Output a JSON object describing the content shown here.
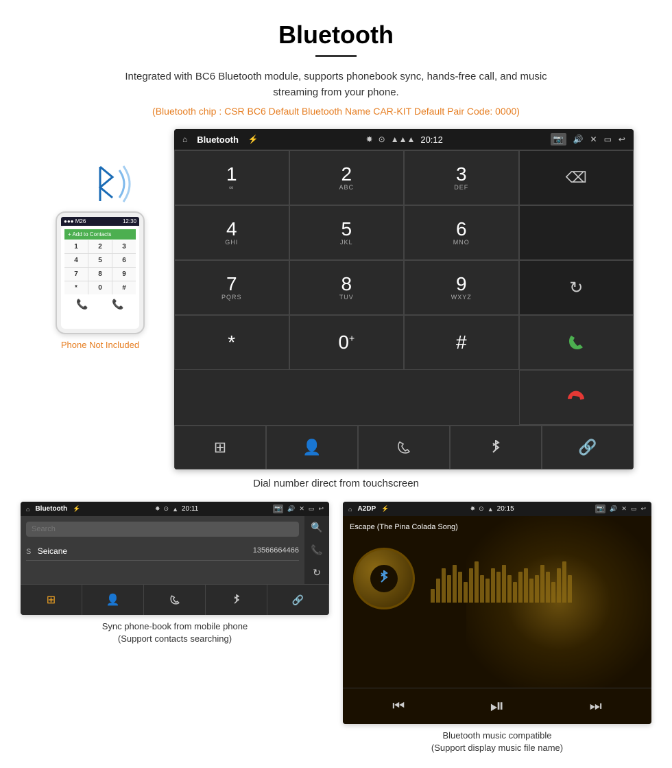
{
  "header": {
    "title": "Bluetooth",
    "subtitle": "Integrated with BC6 Bluetooth module, supports phonebook sync, hands-free call, and music streaming from your phone.",
    "chip_info": "(Bluetooth chip : CSR BC6    Default Bluetooth Name CAR-KIT    Default Pair Code: 0000)"
  },
  "dial_screen": {
    "status_label": "Bluetooth",
    "time": "20:12",
    "keys": [
      {
        "number": "1",
        "letters": "∞",
        "row": 0,
        "col": 0
      },
      {
        "number": "2",
        "letters": "ABC",
        "row": 0,
        "col": 1
      },
      {
        "number": "3",
        "letters": "DEF",
        "row": 0,
        "col": 2
      },
      {
        "number": "4",
        "letters": "GHI",
        "row": 1,
        "col": 0
      },
      {
        "number": "5",
        "letters": "JKL",
        "row": 1,
        "col": 1
      },
      {
        "number": "6",
        "letters": "MNO",
        "row": 1,
        "col": 2
      },
      {
        "number": "7",
        "letters": "PQRS",
        "row": 2,
        "col": 0
      },
      {
        "number": "8",
        "letters": "TUV",
        "row": 2,
        "col": 1
      },
      {
        "number": "9",
        "letters": "WXYZ",
        "row": 2,
        "col": 2
      },
      {
        "number": "*",
        "letters": "",
        "row": 3,
        "col": 0
      },
      {
        "number": "0⁺",
        "letters": "",
        "row": 3,
        "col": 1
      },
      {
        "number": "#",
        "letters": "",
        "row": 3,
        "col": 2
      }
    ],
    "caption": "Dial number direct from touchscreen"
  },
  "phone": {
    "not_included": "Phone Not Included",
    "contact_bar": "+ Add to Contacts",
    "keys": [
      "1",
      "2",
      "3",
      "4",
      "5",
      "6",
      "7",
      "8",
      "9",
      "*",
      "0",
      "#"
    ]
  },
  "phonebook_screen": {
    "status_label": "Bluetooth",
    "time": "20:11",
    "search_placeholder": "Search",
    "contact_name": "Seicane",
    "contact_number": "13566664466",
    "caption_line1": "Sync phone-book from mobile phone",
    "caption_line2": "(Support contacts searching)"
  },
  "music_screen": {
    "status_label": "A2DP",
    "time": "20:15",
    "song_title": "Escape (The Pina Colada Song)",
    "caption_line1": "Bluetooth music compatible",
    "caption_line2": "(Support display music file name)"
  },
  "eq_bars": [
    20,
    35,
    50,
    40,
    55,
    45,
    30,
    50,
    60,
    40,
    35,
    50,
    45,
    55,
    40,
    30,
    45,
    50,
    35,
    40,
    55,
    45,
    30,
    50,
    60,
    40
  ],
  "icons": {
    "home": "⌂",
    "usb": "⚡",
    "bluetooth": "✸",
    "location": "⊙",
    "signal": "▲",
    "camera": "📷",
    "volume": "🔊",
    "close": "✕",
    "window": "▭",
    "back": "↩",
    "backspace": "⌫",
    "rotate": "↻",
    "green_call": "📞",
    "red_call": "📞",
    "grid": "⊞",
    "person": "👤",
    "phone_icon": "📞",
    "bt_icon": "✸",
    "link": "🔗",
    "search": "🔍",
    "prev": "⏮",
    "play_pause": "⏯",
    "next": "⏭"
  }
}
